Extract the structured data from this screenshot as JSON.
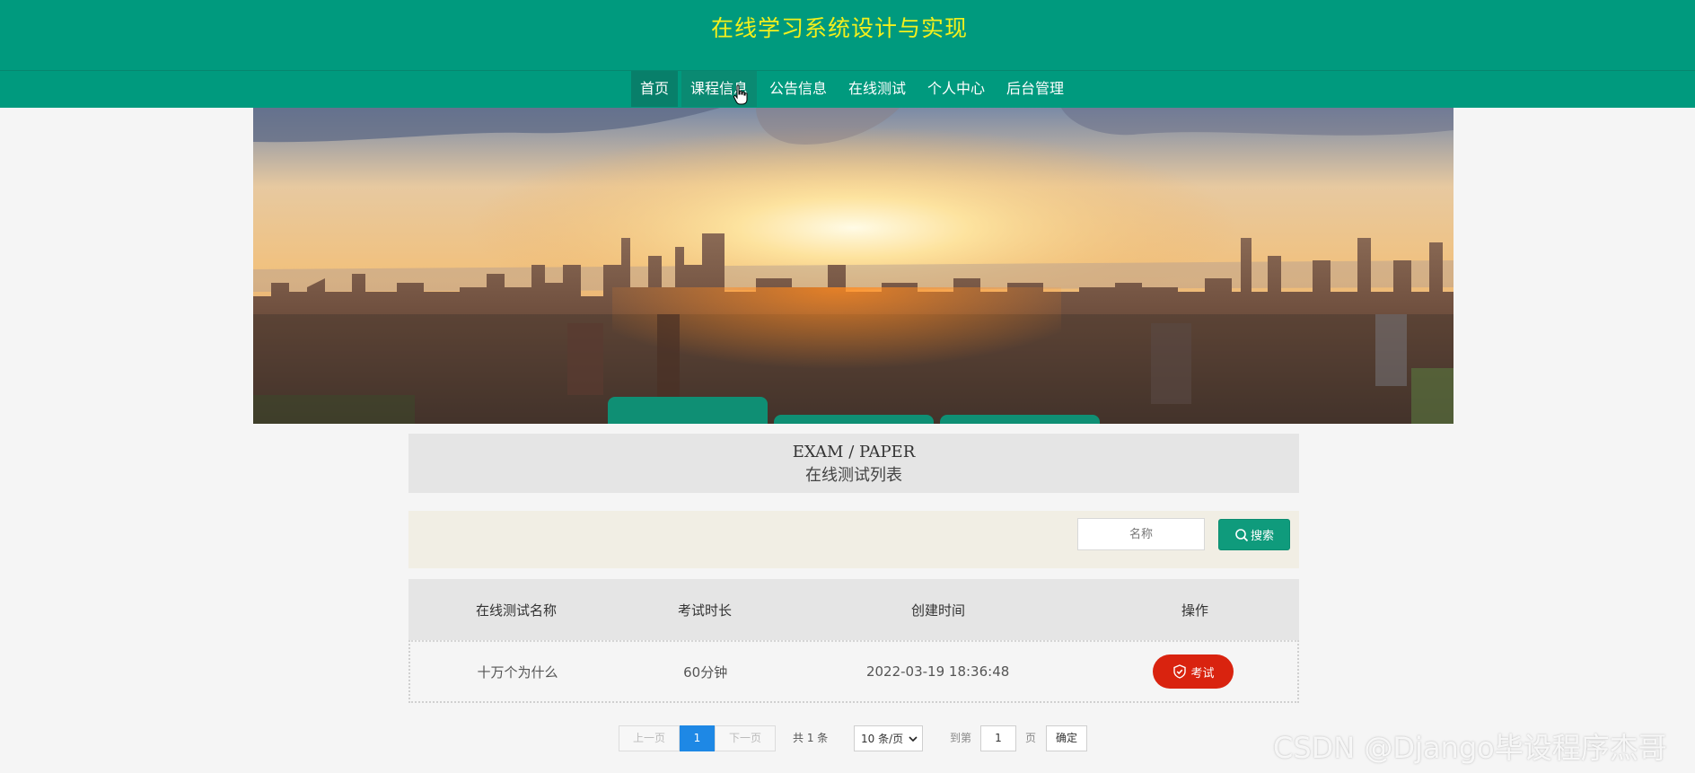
{
  "header": {
    "site_title": "在线学习系统设计与实现",
    "nav": [
      {
        "label": "首页"
      },
      {
        "label": "课程信息"
      },
      {
        "label": "公告信息"
      },
      {
        "label": "在线测试"
      },
      {
        "label": "个人中心"
      },
      {
        "label": "后台管理"
      }
    ]
  },
  "section": {
    "title_en": "EXAM / PAPER",
    "title_cn": "在线测试列表"
  },
  "search": {
    "placeholder": "名称",
    "button_label": "搜索"
  },
  "table": {
    "columns": [
      "在线测试名称",
      "考试时长",
      "创建时间",
      "操作"
    ],
    "rows": [
      {
        "name": "十万个为什么",
        "duration": "60分钟",
        "created": "2022-03-19 18:36:48",
        "action": "考试"
      }
    ]
  },
  "pagination": {
    "prev": "上一页",
    "current": "1",
    "next": "下一页",
    "total": "共 1 条",
    "page_size": "10 条/页",
    "goto_label": "到第",
    "goto_value": "1",
    "page_unit": "页",
    "confirm": "确定"
  },
  "watermark": "CSDN @Django毕设程序杰哥",
  "colors": {
    "header_bg": "#009a7e",
    "title_yellow": "#f4f01c",
    "search_btn": "#0f9b7c",
    "exam_btn": "#d9230f",
    "pager_active": "#1e88e5"
  }
}
